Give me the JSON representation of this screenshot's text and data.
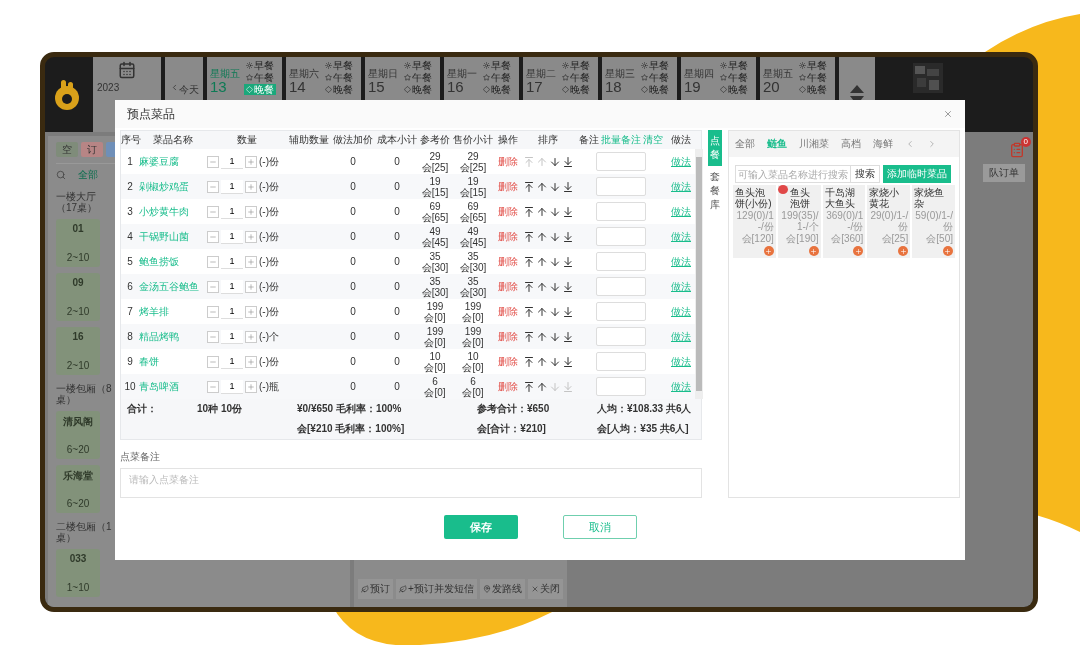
{
  "header": {
    "year": "2023",
    "today_button": "今天",
    "days": [
      {
        "weekday": "星期五",
        "day": "13",
        "selected": true,
        "meals": [
          {
            "label": "早餐",
            "selected": false
          },
          {
            "label": "午餐",
            "selected": false
          },
          {
            "label": "晚餐",
            "selected": true
          }
        ]
      },
      {
        "weekday": "星期六",
        "day": "14",
        "selected": false,
        "meals": [
          {
            "label": "早餐",
            "selected": false
          },
          {
            "label": "午餐",
            "selected": false
          },
          {
            "label": "晚餐",
            "selected": false
          }
        ]
      },
      {
        "weekday": "星期日",
        "day": "15",
        "selected": false,
        "meals": [
          {
            "label": "早餐",
            "selected": false
          },
          {
            "label": "午餐",
            "selected": false
          },
          {
            "label": "晚餐",
            "selected": false
          }
        ]
      },
      {
        "weekday": "星期一",
        "day": "16",
        "selected": false,
        "meals": [
          {
            "label": "早餐",
            "selected": false
          },
          {
            "label": "午餐",
            "selected": false
          },
          {
            "label": "晚餐",
            "selected": false
          }
        ]
      },
      {
        "weekday": "星期二",
        "day": "17",
        "selected": false,
        "meals": [
          {
            "label": "早餐",
            "selected": false
          },
          {
            "label": "午餐",
            "selected": false
          },
          {
            "label": "晚餐",
            "selected": false
          }
        ]
      },
      {
        "weekday": "星期三",
        "day": "18",
        "selected": false,
        "meals": [
          {
            "label": "早餐",
            "selected": false
          },
          {
            "label": "午餐",
            "selected": false
          },
          {
            "label": "晚餐",
            "selected": false
          }
        ]
      },
      {
        "weekday": "星期四",
        "day": "19",
        "selected": false,
        "meals": [
          {
            "label": "早餐",
            "selected": false
          },
          {
            "label": "午餐",
            "selected": false
          },
          {
            "label": "晚餐",
            "selected": false
          }
        ]
      },
      {
        "weekday": "星期五",
        "day": "20",
        "selected": false,
        "meals": [
          {
            "label": "早餐",
            "selected": false
          },
          {
            "label": "午餐",
            "selected": false
          },
          {
            "label": "晚餐",
            "selected": false
          }
        ]
      }
    ]
  },
  "floor_panel": {
    "status_buttons": [
      {
        "label": "空",
        "color": "#7f8c7a"
      },
      {
        "label": "订",
        "color": "#b78585"
      },
      {
        "color": "#6f8fb8"
      }
    ],
    "filter_tab": "全部",
    "areas": [
      {
        "name": "一楼大厅（17桌）",
        "tables": [
          {
            "name": "01",
            "seats": "2~10"
          },
          {
            "name": "09",
            "seats": "2~10"
          },
          {
            "name": "16",
            "seats": "2~10"
          }
        ]
      },
      {
        "name": "一楼包厢（8桌）",
        "tables": [
          {
            "name": "清风阁",
            "seats": "6~20"
          },
          {
            "name": "乐海堂",
            "seats": "6~20"
          }
        ]
      },
      {
        "name": "二楼包厢（1桌）",
        "tables": [
          {
            "name": "033",
            "seats": "1~10"
          }
        ]
      }
    ]
  },
  "order_actions": [
    "预订",
    "+预订并发短信",
    "发路线",
    "关闭"
  ],
  "notification_badge": "0",
  "queue_button": "队订单",
  "dialog": {
    "title": "预点菜品",
    "columns": [
      "序号",
      "菜品名称",
      "数量",
      "辅助数量",
      "做法加价",
      "成本小计",
      "参考价",
      "售价小计",
      "操作",
      "排序",
      "备注",
      "做法"
    ],
    "remark_links": [
      "批量备注",
      "清空"
    ],
    "rows": [
      {
        "no": "1",
        "name": "麻婆豆腐",
        "qty": "1",
        "unit": "(-)份",
        "method_price": "0",
        "cost": "0",
        "ref_price": "29",
        "ref_member": "会[25]",
        "sale_price": "29",
        "sale_member": "会[25]",
        "action": "删除",
        "can_move_up": false,
        "can_move_down": true,
        "method": "做法"
      },
      {
        "no": "2",
        "name": "剁椒炒鸡蛋",
        "qty": "1",
        "unit": "(-)份",
        "method_price": "0",
        "cost": "0",
        "ref_price": "19",
        "ref_member": "会[15]",
        "sale_price": "19",
        "sale_member": "会[15]",
        "action": "删除",
        "can_move_up": true,
        "can_move_down": true,
        "method": "做法"
      },
      {
        "no": "3",
        "name": "小炒黄牛肉",
        "qty": "1",
        "unit": "(-)份",
        "method_price": "0",
        "cost": "0",
        "ref_price": "69",
        "ref_member": "会[65]",
        "sale_price": "69",
        "sale_member": "会[65]",
        "action": "删除",
        "can_move_up": true,
        "can_move_down": true,
        "method": "做法"
      },
      {
        "no": "4",
        "name": "干锅野山菌",
        "qty": "1",
        "unit": "(-)份",
        "method_price": "0",
        "cost": "0",
        "ref_price": "49",
        "ref_member": "会[45]",
        "sale_price": "49",
        "sale_member": "会[45]",
        "action": "删除",
        "can_move_up": true,
        "can_move_down": true,
        "method": "做法"
      },
      {
        "no": "5",
        "name": "鲍鱼捞饭",
        "qty": "1",
        "unit": "(-)份",
        "method_price": "0",
        "cost": "0",
        "ref_price": "35",
        "ref_member": "会[30]",
        "sale_price": "35",
        "sale_member": "会[30]",
        "action": "删除",
        "can_move_up": true,
        "can_move_down": true,
        "method": "做法"
      },
      {
        "no": "6",
        "name": "金汤五谷鲍鱼",
        "qty": "1",
        "unit": "(-)份",
        "method_price": "0",
        "cost": "0",
        "ref_price": "35",
        "ref_member": "会[30]",
        "sale_price": "35",
        "sale_member": "会[30]",
        "action": "删除",
        "can_move_up": true,
        "can_move_down": true,
        "method": "做法"
      },
      {
        "no": "7",
        "name": "烤羊排",
        "qty": "1",
        "unit": "(-)份",
        "method_price": "0",
        "cost": "0",
        "ref_price": "199",
        "ref_member": "会[0]",
        "sale_price": "199",
        "sale_member": "会[0]",
        "action": "删除",
        "can_move_up": true,
        "can_move_down": true,
        "method": "做法"
      },
      {
        "no": "8",
        "name": "精品烤鸭",
        "qty": "1",
        "unit": "(-)个",
        "method_price": "0",
        "cost": "0",
        "ref_price": "199",
        "ref_member": "会[0]",
        "sale_price": "199",
        "sale_member": "会[0]",
        "action": "删除",
        "can_move_up": true,
        "can_move_down": true,
        "method": "做法"
      },
      {
        "no": "9",
        "name": "春饼",
        "qty": "1",
        "unit": "(-)份",
        "method_price": "0",
        "cost": "0",
        "ref_price": "10",
        "ref_member": "会[0]",
        "sale_price": "10",
        "sale_member": "会[0]",
        "action": "删除",
        "can_move_up": true,
        "can_move_down": true,
        "method": "做法"
      },
      {
        "no": "10",
        "name": "青岛啤酒",
        "qty": "1",
        "unit": "(-)瓶",
        "method_price": "0",
        "cost": "0",
        "ref_price": "6",
        "ref_member": "会[0]",
        "sale_price": "6",
        "sale_member": "会[0]",
        "action": "删除",
        "can_move_up": true,
        "can_move_down": false,
        "method": "做法"
      }
    ],
    "totals": {
      "label": "合计：",
      "count": "10种 10份",
      "gross": "¥0/¥650 毛利率：100%",
      "ref_total": "参考合计：¥650",
      "per_person": "人均：¥108.33 共6人",
      "member_gross": "会[¥210 毛利率：100%]",
      "member_total": "会[合计：¥210]",
      "member_per_person": "会[人均：¥35 共6人]"
    },
    "note_label": "点菜备注",
    "note_placeholder": "请输入点菜备注",
    "side_tabs": [
      {
        "label": "点餐",
        "selected": true
      },
      {
        "label": "套餐库",
        "selected": false
      }
    ],
    "categories": [
      {
        "label": "全部",
        "selected": false
      },
      {
        "label": "鲢鱼",
        "selected": true
      },
      {
        "label": "川湘菜",
        "selected": false
      },
      {
        "label": "高档",
        "selected": false
      },
      {
        "label": "海鲜",
        "selected": false
      }
    ],
    "search_placeholder": "可输入菜品名称进行搜索",
    "search_button": "搜索",
    "add_temp_button": "添加临时菜品",
    "dishes": [
      {
        "name": "鱼头泡饼(小份)",
        "price": "129(0)/1-/份",
        "member_price": "会[120]",
        "tagged": false
      },
      {
        "name": "鱼头泡饼",
        "price": "199(35)/1-/个",
        "member_price": "会[190]",
        "tagged": true
      },
      {
        "name": "千岛湖大鱼头",
        "price": "369(0)/1-/份",
        "member_price": "会[360]",
        "tagged": false
      },
      {
        "name": "家烧小黄花",
        "price": "29(0)/1-/份",
        "member_price": "会[25]",
        "tagged": false
      },
      {
        "name": "家烧鱼杂",
        "price": "59(0)/1-/份",
        "member_price": "会[50]",
        "tagged": false
      }
    ],
    "save_button": "保存",
    "cancel_button": "取消"
  }
}
